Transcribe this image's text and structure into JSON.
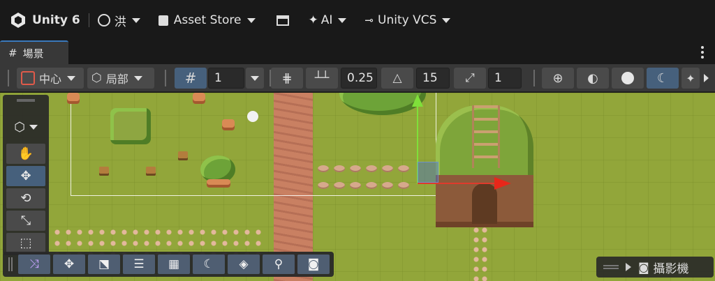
{
  "topbar": {
    "app_name": "Unity 6",
    "account_label": "洪",
    "asset_store_label": "Asset Store",
    "ai_label": "AI",
    "vcs_label": "Unity VCS"
  },
  "tabs": {
    "scene_label": "場景"
  },
  "scene_toolbar": {
    "pivot_label": "中心",
    "space_label": "局部",
    "grid_value": "1",
    "snap_increment": "0.25",
    "rotate_snap": "15",
    "scale_snap": "1"
  },
  "overlay": {
    "camera_label": "攝影機"
  },
  "colors": {
    "accent": "#46607c",
    "tab_highlight": "#3a79bb",
    "gizmo_y": "#7fe03a",
    "gizmo_x": "#e8271a",
    "grass": "#92a63a"
  }
}
